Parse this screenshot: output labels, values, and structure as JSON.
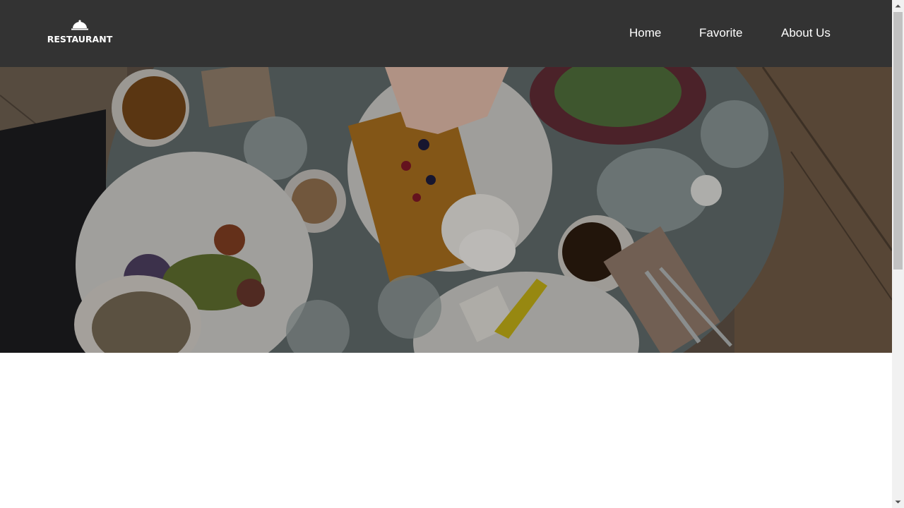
{
  "header": {
    "logo_text": "RESTAURANT",
    "logo_icon": "cloche-icon",
    "background": "#333333"
  },
  "nav": {
    "items": [
      {
        "label": "Home"
      },
      {
        "label": "Favorite"
      },
      {
        "label": "About Us"
      }
    ]
  },
  "hero": {
    "image": "food-table-photo",
    "overlay": "dark"
  },
  "scrollbar": {
    "position": 0.0
  }
}
